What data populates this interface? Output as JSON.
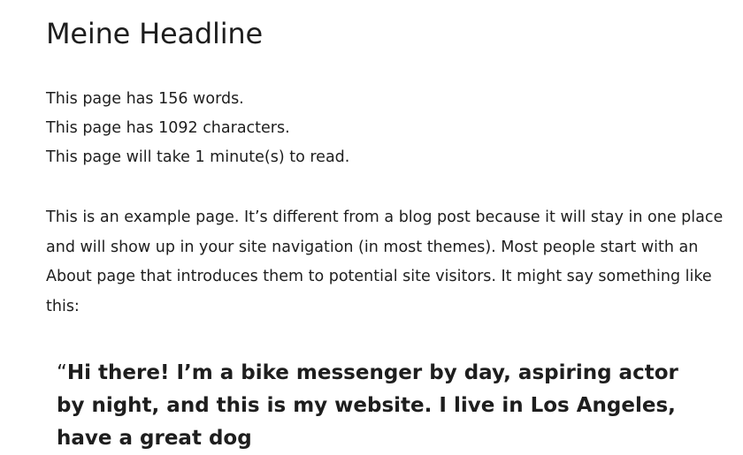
{
  "page": {
    "title": "Meine Headline"
  },
  "stats": {
    "words": "This page has 156 words.",
    "characters": "This page has 1092 characters.",
    "reading_time": "This page will take 1 minute(s) to read."
  },
  "intro": {
    "text": "This is an example page. It’s different from a blog post because it will stay in one place and will show up in your site navigation (in most themes). Most people start with an About page that introduces them to potential site visitors. It might say something like this:"
  },
  "quote": {
    "open_mark": "“",
    "text": "Hi there! I’m a bike messenger by day, aspiring actor by night, and this is my website. I live in Los Angeles, have a great dog"
  }
}
